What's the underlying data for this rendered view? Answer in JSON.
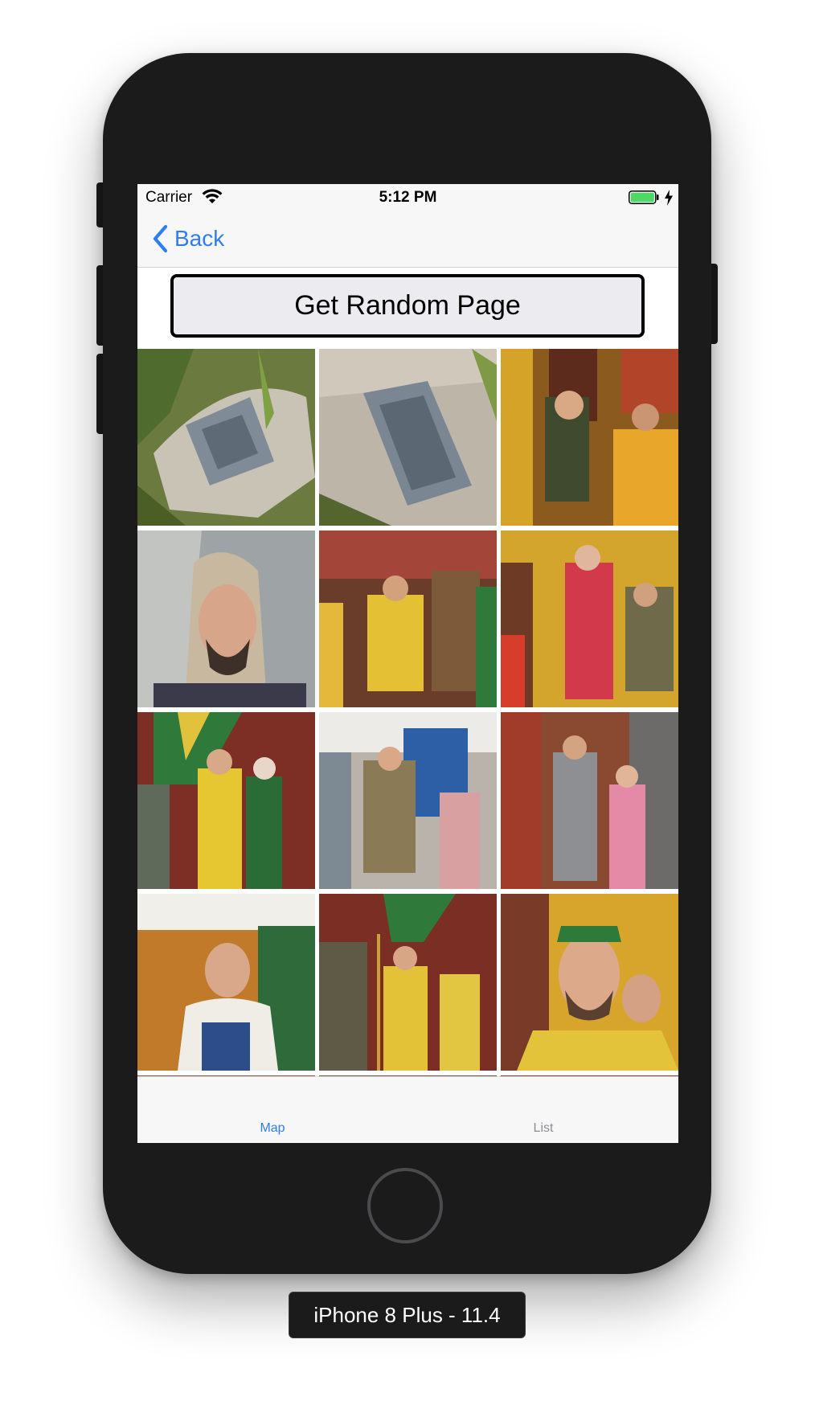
{
  "status_bar": {
    "carrier": "Carrier",
    "time": "5:12 PM",
    "icons": [
      "wifi-icon",
      "battery-icon",
      "charging-icon"
    ],
    "battery_color": "#4cd964"
  },
  "nav_bar": {
    "back_label": "Back",
    "back_icon": "chevron-left-icon",
    "accent": "#2f7df6"
  },
  "random_button": {
    "label": "Get Random Page"
  },
  "photo_grid": {
    "columns": 3,
    "photos": [
      {
        "subject": "carved stone block"
      },
      {
        "subject": "carved stone block close-up"
      },
      {
        "subject": "costumed people at court"
      },
      {
        "subject": "man with hood and beard"
      },
      {
        "subject": "man in yellow tunic"
      },
      {
        "subject": "woman in red dress"
      },
      {
        "subject": "group in yellow and green"
      },
      {
        "subject": "man in brown tunic"
      },
      {
        "subject": "knight in armor"
      },
      {
        "subject": "woman with blue apron"
      },
      {
        "subject": "man in yellow with staff"
      },
      {
        "subject": "man with green crown"
      }
    ]
  },
  "tab_bar": {
    "tabs": [
      {
        "label": "Map",
        "selected": true
      },
      {
        "label": "List",
        "selected": false
      }
    ],
    "active_color": "#2f7df6",
    "inactive_color": "#8e8e93"
  },
  "device_label": "iPhone 8 Plus - 11.4"
}
